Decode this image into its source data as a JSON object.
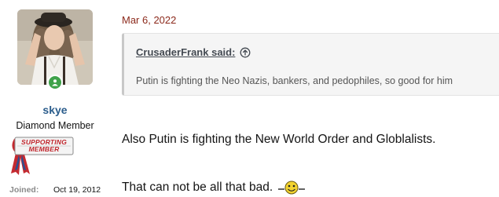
{
  "user": {
    "username": "skye",
    "title": "Diamond Member",
    "badge": {
      "line1": "SUPPORTING",
      "line2": "MEMBER"
    },
    "joined_label": "Joined:",
    "joined_value": "Oct 19, 2012",
    "online_status_color": "#3fa24a"
  },
  "post": {
    "date": "Mar 6, 2022",
    "quote": {
      "author": "CrusaderFrank said:",
      "icon": "arrow-up-circle-icon",
      "text": "Putin is fighting the Neo Nazis, bankers, and pedophiles, so good for him"
    },
    "lines": [
      "Also Putin is fighting the New World Order and Globlalists.",
      "That can not be all that bad."
    ],
    "emoji": "smiley-icon"
  },
  "colors": {
    "username": "#2b5d8c",
    "date": "#8c2a1c",
    "quote_bg": "#f5f5f5",
    "badge_text": "#c0262d"
  }
}
